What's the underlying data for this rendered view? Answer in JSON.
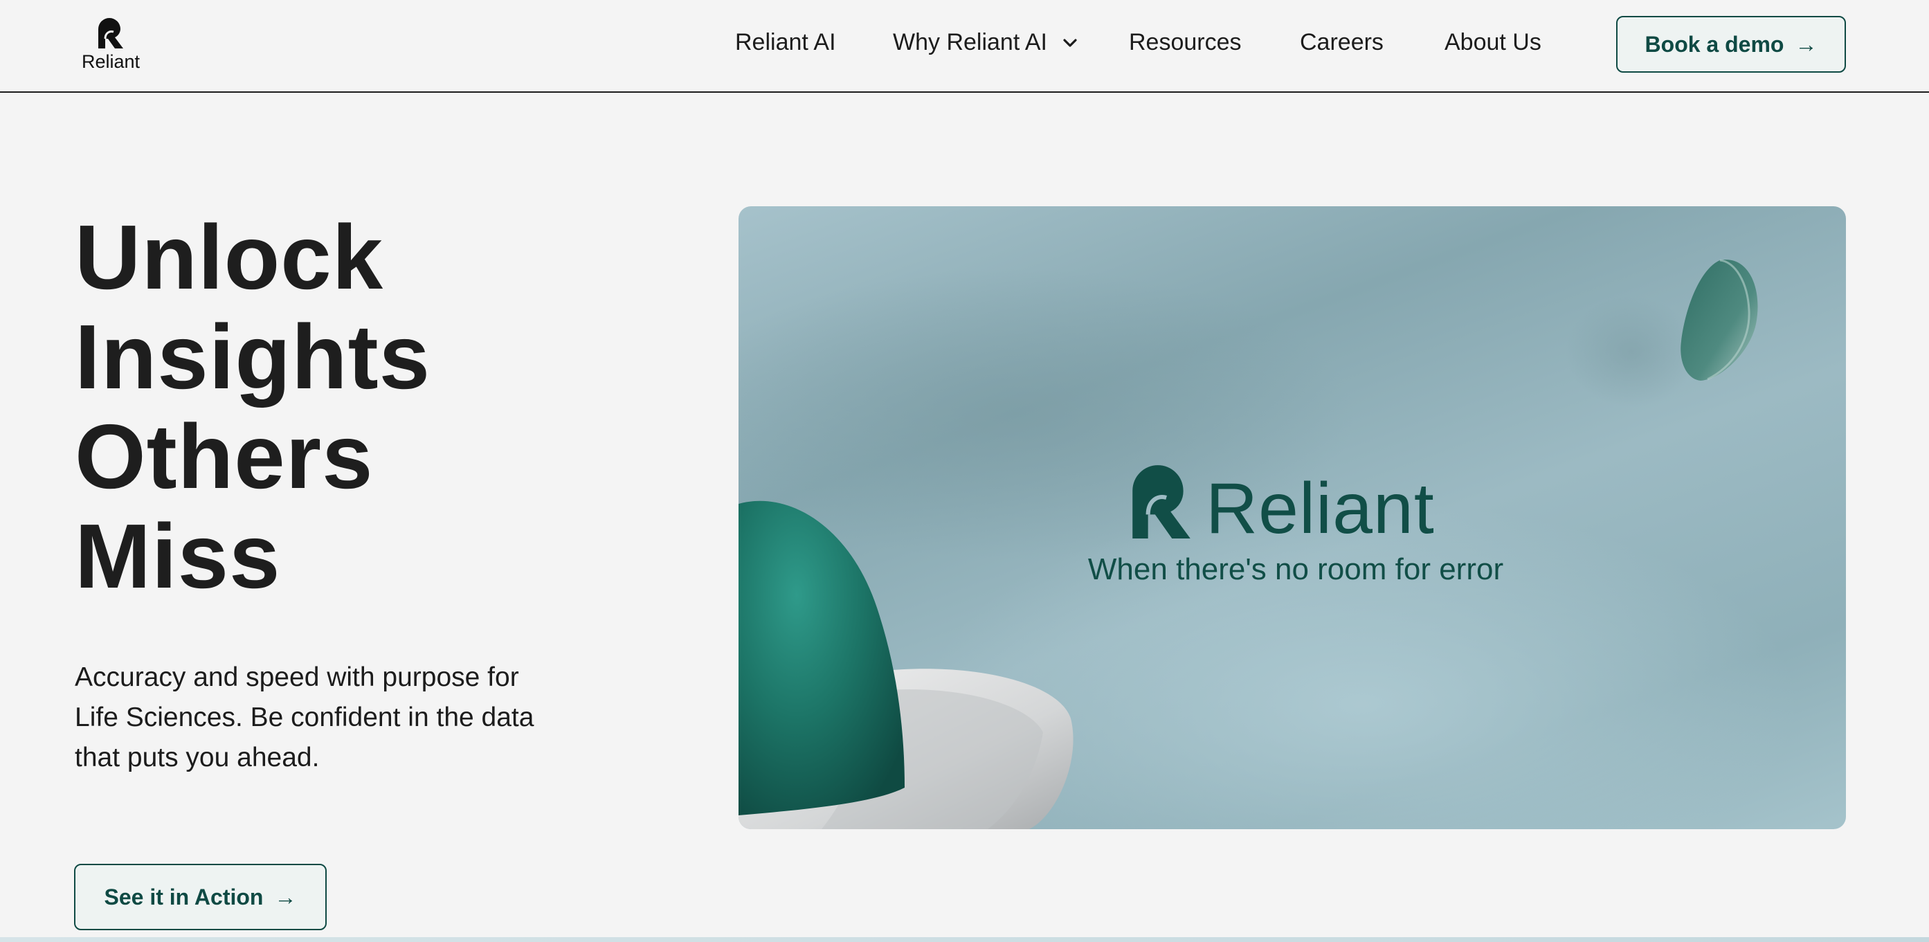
{
  "header": {
    "logo_text": "Reliant",
    "nav": [
      {
        "label": "Reliant AI"
      },
      {
        "label": "Why Reliant AI",
        "has_dropdown": true,
        "icon": "chevron-down-icon"
      },
      {
        "label": "Resources"
      },
      {
        "label": "Careers"
      },
      {
        "label": "About Us"
      }
    ],
    "cta": {
      "label": "Book a demo",
      "arrow": "→"
    }
  },
  "hero": {
    "title_lines": [
      "Unlock",
      "Insights",
      "Others",
      "Miss"
    ],
    "subtitle": "Accuracy and speed with purpose for Life Sciences. Be confident in the data that puts you ahead.",
    "cta": {
      "label": "See it in Action",
      "arrow": "→"
    }
  },
  "media": {
    "brand": "Reliant",
    "tagline": "When there's no room for error"
  },
  "colors": {
    "brand": "#0f4a44",
    "background": "#f4f4f4",
    "button_bg": "#eef3f2"
  }
}
